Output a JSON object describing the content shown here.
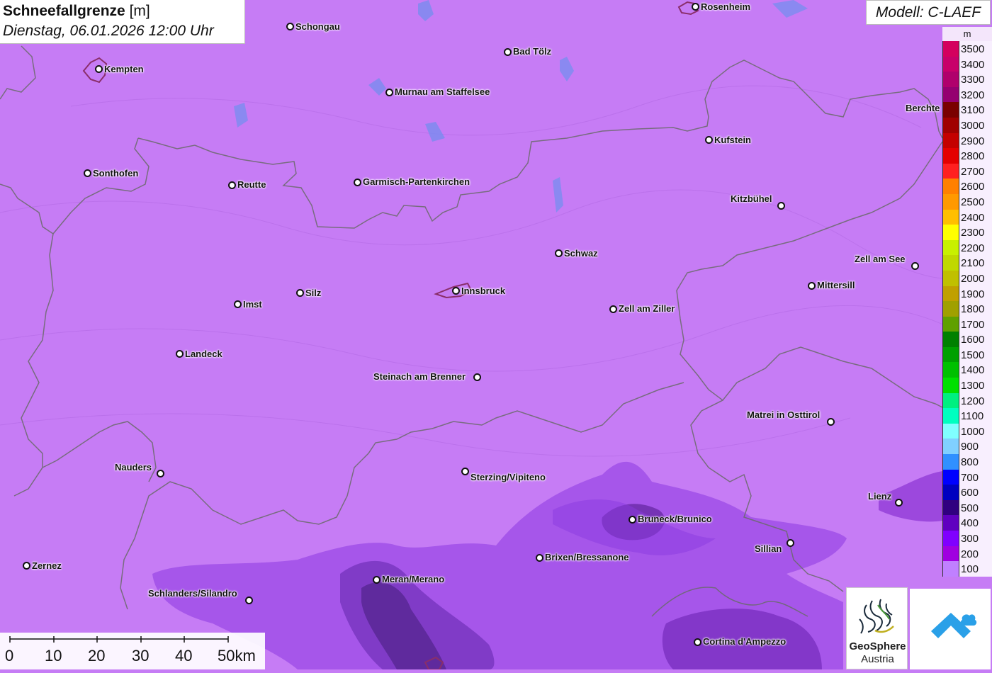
{
  "header": {
    "title": "Schneefallgrenze",
    "unit": "[m]",
    "datetime": "Dienstag, 06.01.2026 12:00 Uhr",
    "model": "Modell: C-LAEF"
  },
  "legend": {
    "unit": "m",
    "entries": [
      {
        "value": "3500",
        "color": "#d4005e"
      },
      {
        "value": "3400",
        "color": "#c8006a"
      },
      {
        "value": "3300",
        "color": "#b0006c"
      },
      {
        "value": "3200",
        "color": "#950070"
      },
      {
        "value": "3100",
        "color": "#7a0000"
      },
      {
        "value": "3000",
        "color": "#a00000"
      },
      {
        "value": "2900",
        "color": "#c40000"
      },
      {
        "value": "2800",
        "color": "#e40000"
      },
      {
        "value": "2700",
        "color": "#ff2020"
      },
      {
        "value": "2600",
        "color": "#ff8000"
      },
      {
        "value": "2500",
        "color": "#ff9900"
      },
      {
        "value": "2400",
        "color": "#ffbf00"
      },
      {
        "value": "2300",
        "color": "#ffff00"
      },
      {
        "value": "2200",
        "color": "#c8f000"
      },
      {
        "value": "2100",
        "color": "#c0d800"
      },
      {
        "value": "2000",
        "color": "#c0c000"
      },
      {
        "value": "1900",
        "color": "#c0a000"
      },
      {
        "value": "1800",
        "color": "#a0a000"
      },
      {
        "value": "1700",
        "color": "#60a000"
      },
      {
        "value": "1600",
        "color": "#008000"
      },
      {
        "value": "1500",
        "color": "#00a000"
      },
      {
        "value": "1400",
        "color": "#00c000"
      },
      {
        "value": "1300",
        "color": "#00e000"
      },
      {
        "value": "1200",
        "color": "#00f080"
      },
      {
        "value": "1100",
        "color": "#00ffc0"
      },
      {
        "value": "1000",
        "color": "#80ffff"
      },
      {
        "value": "900",
        "color": "#80d0ff"
      },
      {
        "value": "800",
        "color": "#3090ff"
      },
      {
        "value": "700",
        "color": "#0000ff"
      },
      {
        "value": "600",
        "color": "#0000c0"
      },
      {
        "value": "500",
        "color": "#300080"
      },
      {
        "value": "400",
        "color": "#6000c0"
      },
      {
        "value": "300",
        "color": "#8000ff"
      },
      {
        "value": "200",
        "color": "#a000e0"
      },
      {
        "value": "100",
        "color": "#c080ff"
      }
    ]
  },
  "cities": [
    {
      "name": "Schongau"
    },
    {
      "name": "Rosenheim"
    },
    {
      "name": "Kempten"
    },
    {
      "name": "Bad Tölz"
    },
    {
      "name": "Murnau am Staffelsee"
    },
    {
      "name": "Berchte"
    },
    {
      "name": "Kufstein"
    },
    {
      "name": "Sonthofen"
    },
    {
      "name": "Reutte"
    },
    {
      "name": "Garmisch-Partenkirchen"
    },
    {
      "name": "Kitzbühel"
    },
    {
      "name": "Schwaz"
    },
    {
      "name": "Zell am See"
    },
    {
      "name": "Mittersill"
    },
    {
      "name": "Innsbruck"
    },
    {
      "name": "Silz"
    },
    {
      "name": "Imst"
    },
    {
      "name": "Zell am Ziller"
    },
    {
      "name": "Landeck"
    },
    {
      "name": "Steinach am Brenner"
    },
    {
      "name": "Matrei in Osttirol"
    },
    {
      "name": "Nauders"
    },
    {
      "name": "Sterzing/Vipiteno"
    },
    {
      "name": "Lienz"
    },
    {
      "name": "Bruneck/Brunico"
    },
    {
      "name": "Sillian"
    },
    {
      "name": "Brixen/Bressanone"
    },
    {
      "name": "Zernez"
    },
    {
      "name": "Meran/Merano"
    },
    {
      "name": "Schlanders/Silandro"
    },
    {
      "name": "Cortina d'Ampezzo"
    }
  ],
  "scalebar": {
    "labels": [
      "0",
      "10",
      "20",
      "30",
      "40",
      "50km"
    ]
  },
  "logos": {
    "geosphere_line1": "GeoSphere",
    "geosphere_line2": "Austria"
  }
}
